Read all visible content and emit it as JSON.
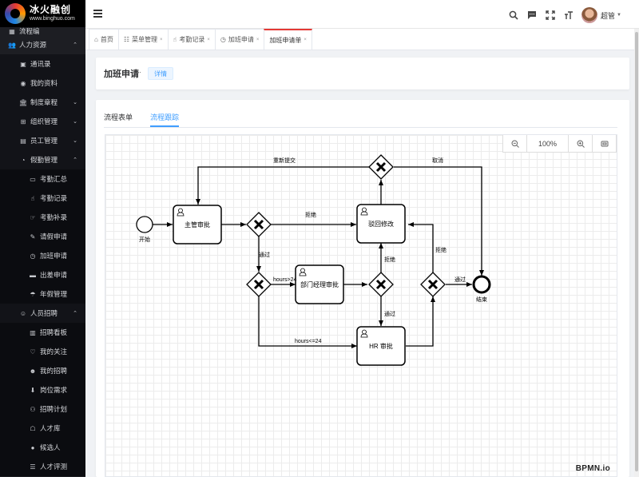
{
  "brand": {
    "title": "冰火融创",
    "url": "www.binghuo.com"
  },
  "sidebar": {
    "items": [
      {
        "label": "流程编",
        "level": 1,
        "icon": "grid-icon",
        "partial": true
      },
      {
        "label": "人力资源",
        "level": 1,
        "icon": "users-icon",
        "arrow": "up"
      },
      {
        "label": "通讯录",
        "level": 2,
        "icon": "contacts-icon"
      },
      {
        "label": "我的资料",
        "level": 2,
        "icon": "person-icon"
      },
      {
        "label": "制度章程",
        "level": 2,
        "icon": "bank-icon",
        "arrow": "down"
      },
      {
        "label": "组织管理",
        "level": 2,
        "icon": "org-icon",
        "arrow": "down"
      },
      {
        "label": "员工管理",
        "level": 2,
        "icon": "id-card-icon",
        "arrow": "down"
      },
      {
        "label": "假勤管理",
        "level": 2,
        "icon": "bell-icon",
        "arrow": "up"
      },
      {
        "label": "考勤汇总",
        "level": 3,
        "icon": "summary-icon"
      },
      {
        "label": "考勤记录",
        "level": 3,
        "icon": "hand-icon"
      },
      {
        "label": "考勤补录",
        "level": 3,
        "icon": "hand-point-icon"
      },
      {
        "label": "请假申请",
        "level": 3,
        "icon": "doc-edit-icon"
      },
      {
        "label": "加班申请",
        "level": 3,
        "icon": "clock-icon"
      },
      {
        "label": "出差申请",
        "level": 3,
        "icon": "briefcase-icon"
      },
      {
        "label": "年假管理",
        "level": 3,
        "icon": "vacation-icon"
      },
      {
        "label": "人员招聘",
        "level": 2,
        "icon": "recruit-icon",
        "arrow": "up"
      },
      {
        "label": "招聘看板",
        "level": 3,
        "icon": "board-icon"
      },
      {
        "label": "我的关注",
        "level": 3,
        "icon": "follow-icon"
      },
      {
        "label": "我的招聘",
        "level": 3,
        "icon": "my-recruit-icon"
      },
      {
        "label": "岗位需求",
        "level": 3,
        "icon": "download-icon"
      },
      {
        "label": "招聘计划",
        "level": 3,
        "icon": "plan-icon"
      },
      {
        "label": "人才库",
        "level": 3,
        "icon": "talent-icon"
      },
      {
        "label": "候选人",
        "level": 3,
        "icon": "candidate-icon"
      },
      {
        "label": "人才评测",
        "level": 3,
        "icon": "assess-icon"
      }
    ]
  },
  "header": {
    "user_name": "超管"
  },
  "tabs": [
    {
      "label": "首页",
      "icon": "home-icon",
      "closable": false,
      "active": false
    },
    {
      "label": "菜单管理",
      "icon": "menu-tree-icon",
      "closable": true,
      "active": false
    },
    {
      "label": "考勤记录",
      "icon": "hand-icon",
      "closable": true,
      "active": false
    },
    {
      "label": "加班申请",
      "icon": "clock-icon",
      "closable": true,
      "active": false
    },
    {
      "label": "加班申请单",
      "icon": "",
      "closable": true,
      "active": true
    }
  ],
  "page": {
    "title": "加班申请",
    "dot": "·",
    "tag": "详情"
  },
  "inner_tabs": [
    {
      "label": "流程表单",
      "active": false
    },
    {
      "label": "流程跟踪",
      "active": true
    }
  ],
  "zoom": {
    "value": "100%"
  },
  "diagram": {
    "nodes": {
      "start": "开始",
      "end": "结束",
      "supervisor": "主管审批",
      "revise": "驳回修改",
      "dept": "部门经理审批",
      "hr": "HR 审批"
    },
    "flows": {
      "resubmit": "重新提交",
      "cancel": "取消",
      "reject1": "拒绝",
      "pass1": "通过",
      "hours_gt": "hours>24",
      "hours_le": "hours<=24",
      "reject2": "拒绝",
      "pass2": "通过",
      "reject3": "拒绝",
      "pass3": "通过"
    },
    "logo": "BPMN.io"
  }
}
